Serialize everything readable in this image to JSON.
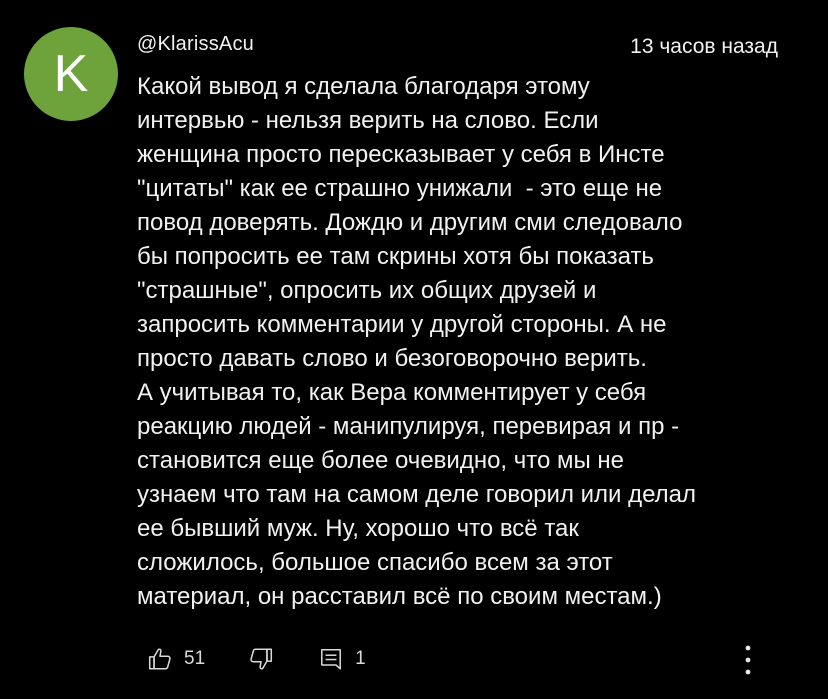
{
  "comment": {
    "avatar": {
      "letter": "K",
      "color": "#6ea33c"
    },
    "author": "@KlarissAcu",
    "timestamp": "13 часов назад",
    "text_lines": [
      "Какой вывод я сделала благодаря этому",
      "интервью - нельзя верить на слово. Если",
      "женщина просто пересказывает у себя в Инсте",
      "\"цитаты\" как ее страшно унижали  - это еще не",
      "повод доверять. Дождю и другим сми следовало",
      "бы попросить ее там скрины хотя бы показать",
      "\"страшные\", опросить их общих друзей и",
      "запросить комментарии у другой стороны. А не",
      "просто давать слово и безоговорочно верить.",
      "А учитывая то, как Вера комментирует у себя",
      "реакцию людей - манипулируя, перевирая и пр -",
      "становится еще более очевидно, что мы не",
      "узнаем что там на самом деле говорил или делал",
      "ее бывший муж. Ну, хорошо что всё так",
      "сложилось, большое спасибо всем за этот",
      "материал, он расставил всё по своим местам.)"
    ],
    "actions": {
      "like_icon": "thumbs-up-icon",
      "like_count": "51",
      "dislike_icon": "thumbs-down-icon",
      "replies_icon": "reply-comment-icon",
      "replies_count": "1",
      "more_icon": "vertical-ellipsis-icon"
    }
  }
}
